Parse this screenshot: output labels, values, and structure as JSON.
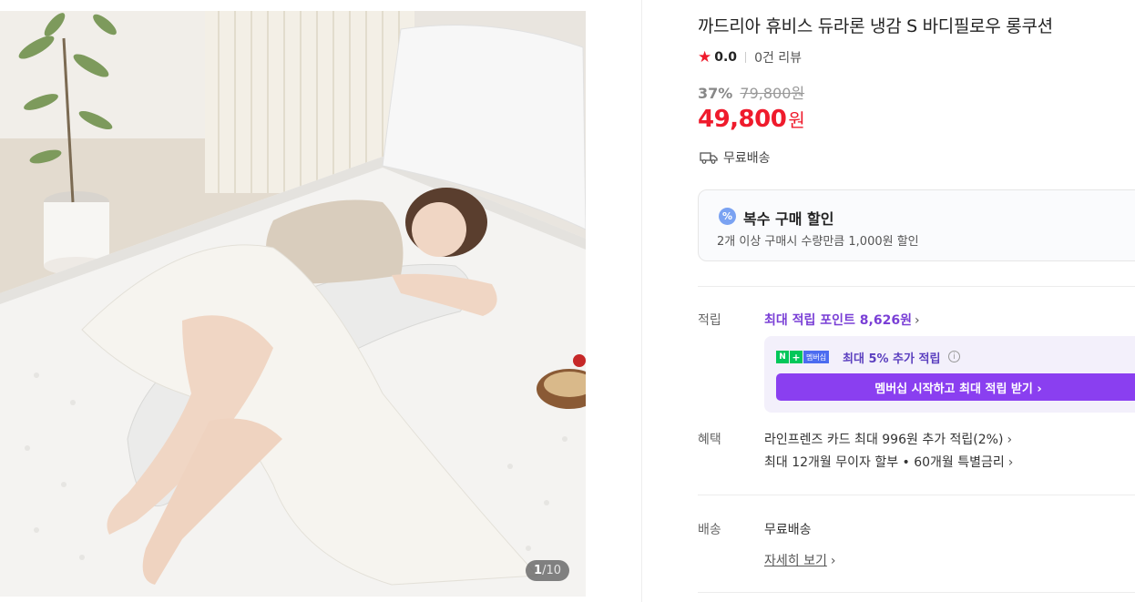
{
  "product": {
    "title": "까드리아 휴비스 듀라론 냉감 S 바디필로우 롱쿠션",
    "rating": "0.0",
    "review_count": "0건 리뷰",
    "discount_rate": "37%",
    "original_price": "79,800원",
    "sale_price": "49,800",
    "currency": "원",
    "shipping": "무료배송",
    "image_counter_current": "1",
    "image_counter_total": "/10"
  },
  "bulk_discount": {
    "icon": "%",
    "title": "복수 구매 할인",
    "desc": "2개 이상 구매시 수량만큼 1,000원 할인"
  },
  "points": {
    "label": "적립",
    "max_points": "최대 적립 포인트 8,626원",
    "membership_badge": "멤버십",
    "membership_text": "최대 5% 추가 적립",
    "membership_button": "멤버십 시작하고 최대 적립 받기 ›"
  },
  "benefits": {
    "label": "혜택",
    "line1": "라인프렌즈 카드 최대 996원 추가 적립(2%)",
    "line2": "최대 12개월 무이자 할부 • 60개월 특별금리"
  },
  "delivery": {
    "label": "배송",
    "value": "무료배송",
    "detail_link": "자세히 보기"
  },
  "colors": {
    "accent_red": "#ef1b2c",
    "accent_purple": "#8a3ff0",
    "naver_green": "#03c75a"
  }
}
